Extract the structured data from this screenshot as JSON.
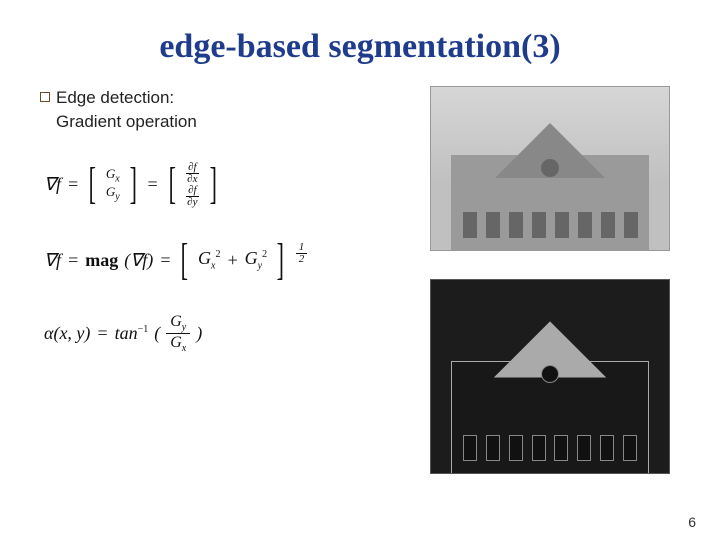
{
  "title": "edge-based segmentation(3)",
  "bullet": {
    "line1": "Edge detection:",
    "line2": "Gradient operation"
  },
  "formulas": {
    "grad_vec_lhs": "∇f",
    "eq": "=",
    "Gx": "Gx",
    "Gy": "Gy",
    "df_dx_num": "∂f",
    "df_dx_den": "∂x",
    "df_dy_num": "∂f",
    "df_dy_den": "∂y",
    "mag_lhs": "∇f",
    "mag_fn": "mag",
    "mag_arg": "(∇f)",
    "mag_expr_a": "G",
    "mag_expr_x": "x",
    "mag_expr_y": "y",
    "mag_plus": " + ",
    "mag_pow": "2",
    "mag_root_num": "1",
    "mag_root_den": "2",
    "alpha_lhs": "α(x, y)",
    "tan": "tan",
    "tan_pow": "−1",
    "open": "(",
    "close": ")"
  },
  "page_number": "6",
  "images": {
    "top_alt": "grayscale-building-photo",
    "bottom_alt": "edge-detected-building"
  }
}
